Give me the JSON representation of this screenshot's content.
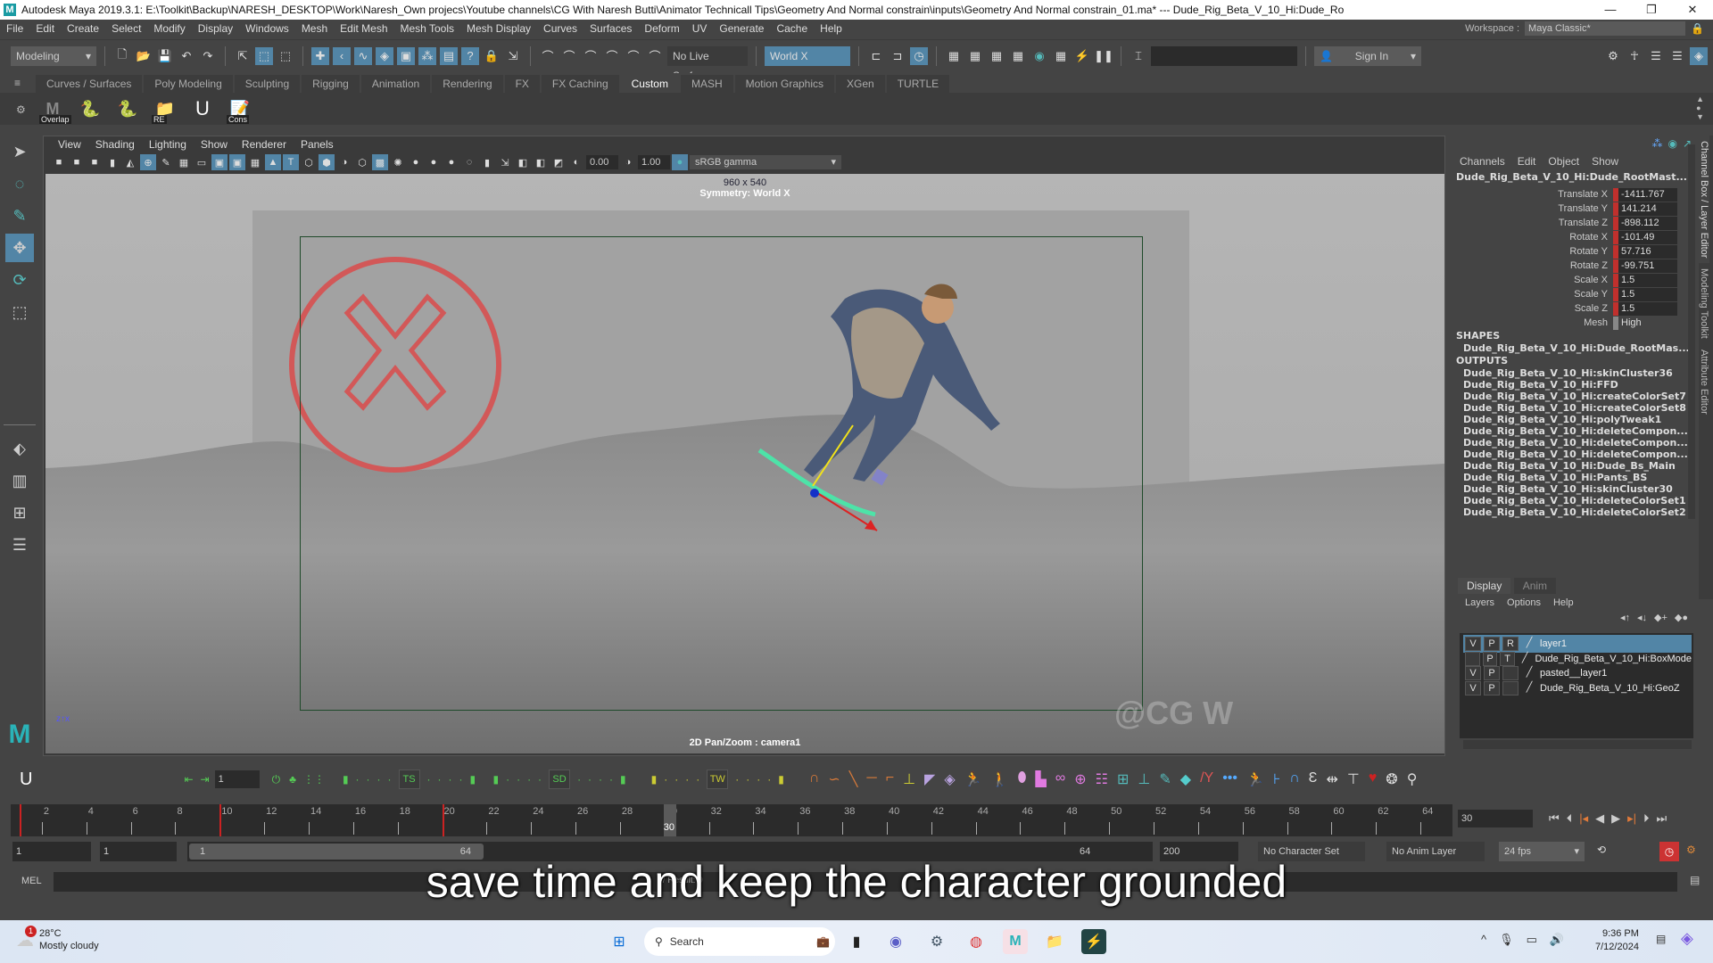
{
  "window": {
    "title": "Autodesk Maya 2019.3.1: E:\\Toolkit\\Backup\\NARESH_DESKTOP\\Work\\Naresh_Own projecs\\Youtube channels\\CG With Naresh Butti\\Animator Technicall Tips\\Geometry And Normal constrain\\inputs\\Geometry And Normal constrain_01.ma*  ---  Dude_Rig_Beta_V_10_Hi:Dude_Ro",
    "minimize": "—",
    "maximize": "❐",
    "close": "✕"
  },
  "menubar": {
    "items": [
      "File",
      "Edit",
      "Create",
      "Select",
      "Modify",
      "Display",
      "Windows",
      "Mesh",
      "Edit Mesh",
      "Mesh Tools",
      "Mesh Display",
      "Curves",
      "Surfaces",
      "Deform",
      "UV",
      "Generate",
      "Cache",
      "Help"
    ],
    "workspace_label": "Workspace :",
    "workspace_value": "Maya Classic*"
  },
  "statusline": {
    "mode": "Modeling",
    "live_surface": "No Live Surface",
    "symmetry": "World X",
    "sign_in": "Sign In"
  },
  "shelf": {
    "tabs": [
      "Curves / Surfaces",
      "Poly Modeling",
      "Sculpting",
      "Rigging",
      "Animation",
      "Rendering",
      "FX",
      "FX Caching",
      "Custom",
      "MASH",
      "Motion Graphics",
      "XGen",
      "TURTLE"
    ],
    "active_tab": "Custom",
    "buttons": [
      {
        "icon": "maya-overlap-icon",
        "label": "Overlap"
      },
      {
        "icon": "python-icon",
        "label": ""
      },
      {
        "icon": "python-icon",
        "label": ""
      },
      {
        "icon": "folder-icon",
        "label": "RE"
      },
      {
        "icon": "magnet-icon",
        "label": ""
      },
      {
        "icon": "notepad-icon",
        "label": "Cons"
      }
    ]
  },
  "viewport": {
    "menu": [
      "View",
      "Shading",
      "Lighting",
      "Show",
      "Renderer",
      "Panels"
    ],
    "exposure": "0.00",
    "gamma": "1.00",
    "color_space": "sRGB gamma",
    "resolution": "960 x 540",
    "symmetry_hud": "Symmetry: World X",
    "camera_hud": "2D Pan/Zoom : camera1",
    "watermark": "@CG W"
  },
  "channel_box": {
    "menu": [
      "Channels",
      "Edit",
      "Object",
      "Show"
    ],
    "object": "Dude_Rig_Beta_V_10_Hi:Dude_RootMast...",
    "channels": [
      {
        "name": "Translate X",
        "value": "-1411.767"
      },
      {
        "name": "Translate Y",
        "value": "141.214"
      },
      {
        "name": "Translate Z",
        "value": "-898.112"
      },
      {
        "name": "Rotate X",
        "value": "-101.49"
      },
      {
        "name": "Rotate Y",
        "value": "57.716"
      },
      {
        "name": "Rotate Z",
        "value": "-99.751"
      },
      {
        "name": "Scale X",
        "value": "1.5"
      },
      {
        "name": "Scale Y",
        "value": "1.5"
      },
      {
        "name": "Scale Z",
        "value": "1.5"
      },
      {
        "name": "Mesh",
        "value": "High"
      }
    ],
    "shapes_label": "SHAPES",
    "shapes": [
      "Dude_Rig_Beta_V_10_Hi:Dude_RootMas..."
    ],
    "outputs_label": "OUTPUTS",
    "outputs": [
      "Dude_Rig_Beta_V_10_Hi:skinCluster36",
      "Dude_Rig_Beta_V_10_Hi:FFD",
      "Dude_Rig_Beta_V_10_Hi:createColorSet7",
      "Dude_Rig_Beta_V_10_Hi:createColorSet8",
      "Dude_Rig_Beta_V_10_Hi:polyTweak1",
      "Dude_Rig_Beta_V_10_Hi:deleteCompon...",
      "Dude_Rig_Beta_V_10_Hi:deleteCompon...",
      "Dude_Rig_Beta_V_10_Hi:deleteCompon...",
      "Dude_Rig_Beta_V_10_Hi:Dude_Bs_Main",
      "Dude_Rig_Beta_V_10_Hi:Pants_BS",
      "Dude_Rig_Beta_V_10_Hi:skinCluster30",
      "Dude_Rig_Beta_V_10_Hi:deleteColorSet1",
      "Dude_Rig_Beta_V_10_Hi:deleteColorSet2"
    ]
  },
  "side_tabs": [
    "Channel Box / Layer Editor",
    "Modeling Toolkit",
    "Attribute Editor"
  ],
  "layer_editor": {
    "tabs": [
      "Display",
      "Anim"
    ],
    "menu": [
      "Layers",
      "Options",
      "Help"
    ],
    "layers": [
      {
        "v": "V",
        "p": "P",
        "r": "R",
        "name": "layer1",
        "selected": true
      },
      {
        "v": "",
        "p": "P",
        "r": "T",
        "name": "Dude_Rig_Beta_V_10_Hi:BoxMode",
        "selected": false
      },
      {
        "v": "V",
        "p": "P",
        "r": "",
        "name": "pasted__layer1",
        "selected": false
      },
      {
        "v": "V",
        "p": "P",
        "r": "",
        "name": "Dude_Rig_Beta_V_10_Hi:GeoZ",
        "selected": false
      }
    ]
  },
  "anim_toolbar": {
    "frame_field": "1",
    "badges": [
      "TS",
      "SD",
      "TW"
    ]
  },
  "timeline": {
    "start": 1,
    "end": 64,
    "current_frame": 30,
    "tick_labels": [
      2,
      4,
      6,
      8,
      10,
      12,
      14,
      16,
      18,
      20,
      22,
      24,
      26,
      28,
      30,
      32,
      34,
      36,
      38,
      40,
      42,
      44,
      46,
      48,
      50,
      52,
      54,
      56,
      58,
      60,
      62,
      64
    ],
    "keyframes": [
      1,
      10,
      20,
      30
    ],
    "current_frame_field": "30"
  },
  "range": {
    "anim_start": "1",
    "playback_start": "1",
    "slider_start": "1",
    "slider_end": "64",
    "playback_end": "64",
    "anim_end": "200",
    "character_set": "No Character Set",
    "anim_layer": "No Anim Layer",
    "fps": "24 fps"
  },
  "command_line": {
    "lang": "MEL",
    "result": "// Result: 9"
  },
  "subtitle": "save time and keep the character grounded",
  "taskbar": {
    "weather_temp": "28°C",
    "weather_desc": "Mostly cloudy",
    "weather_badge": "1",
    "search_placeholder": "Search",
    "time": "9:36 PM",
    "date": "7/12/2024"
  }
}
